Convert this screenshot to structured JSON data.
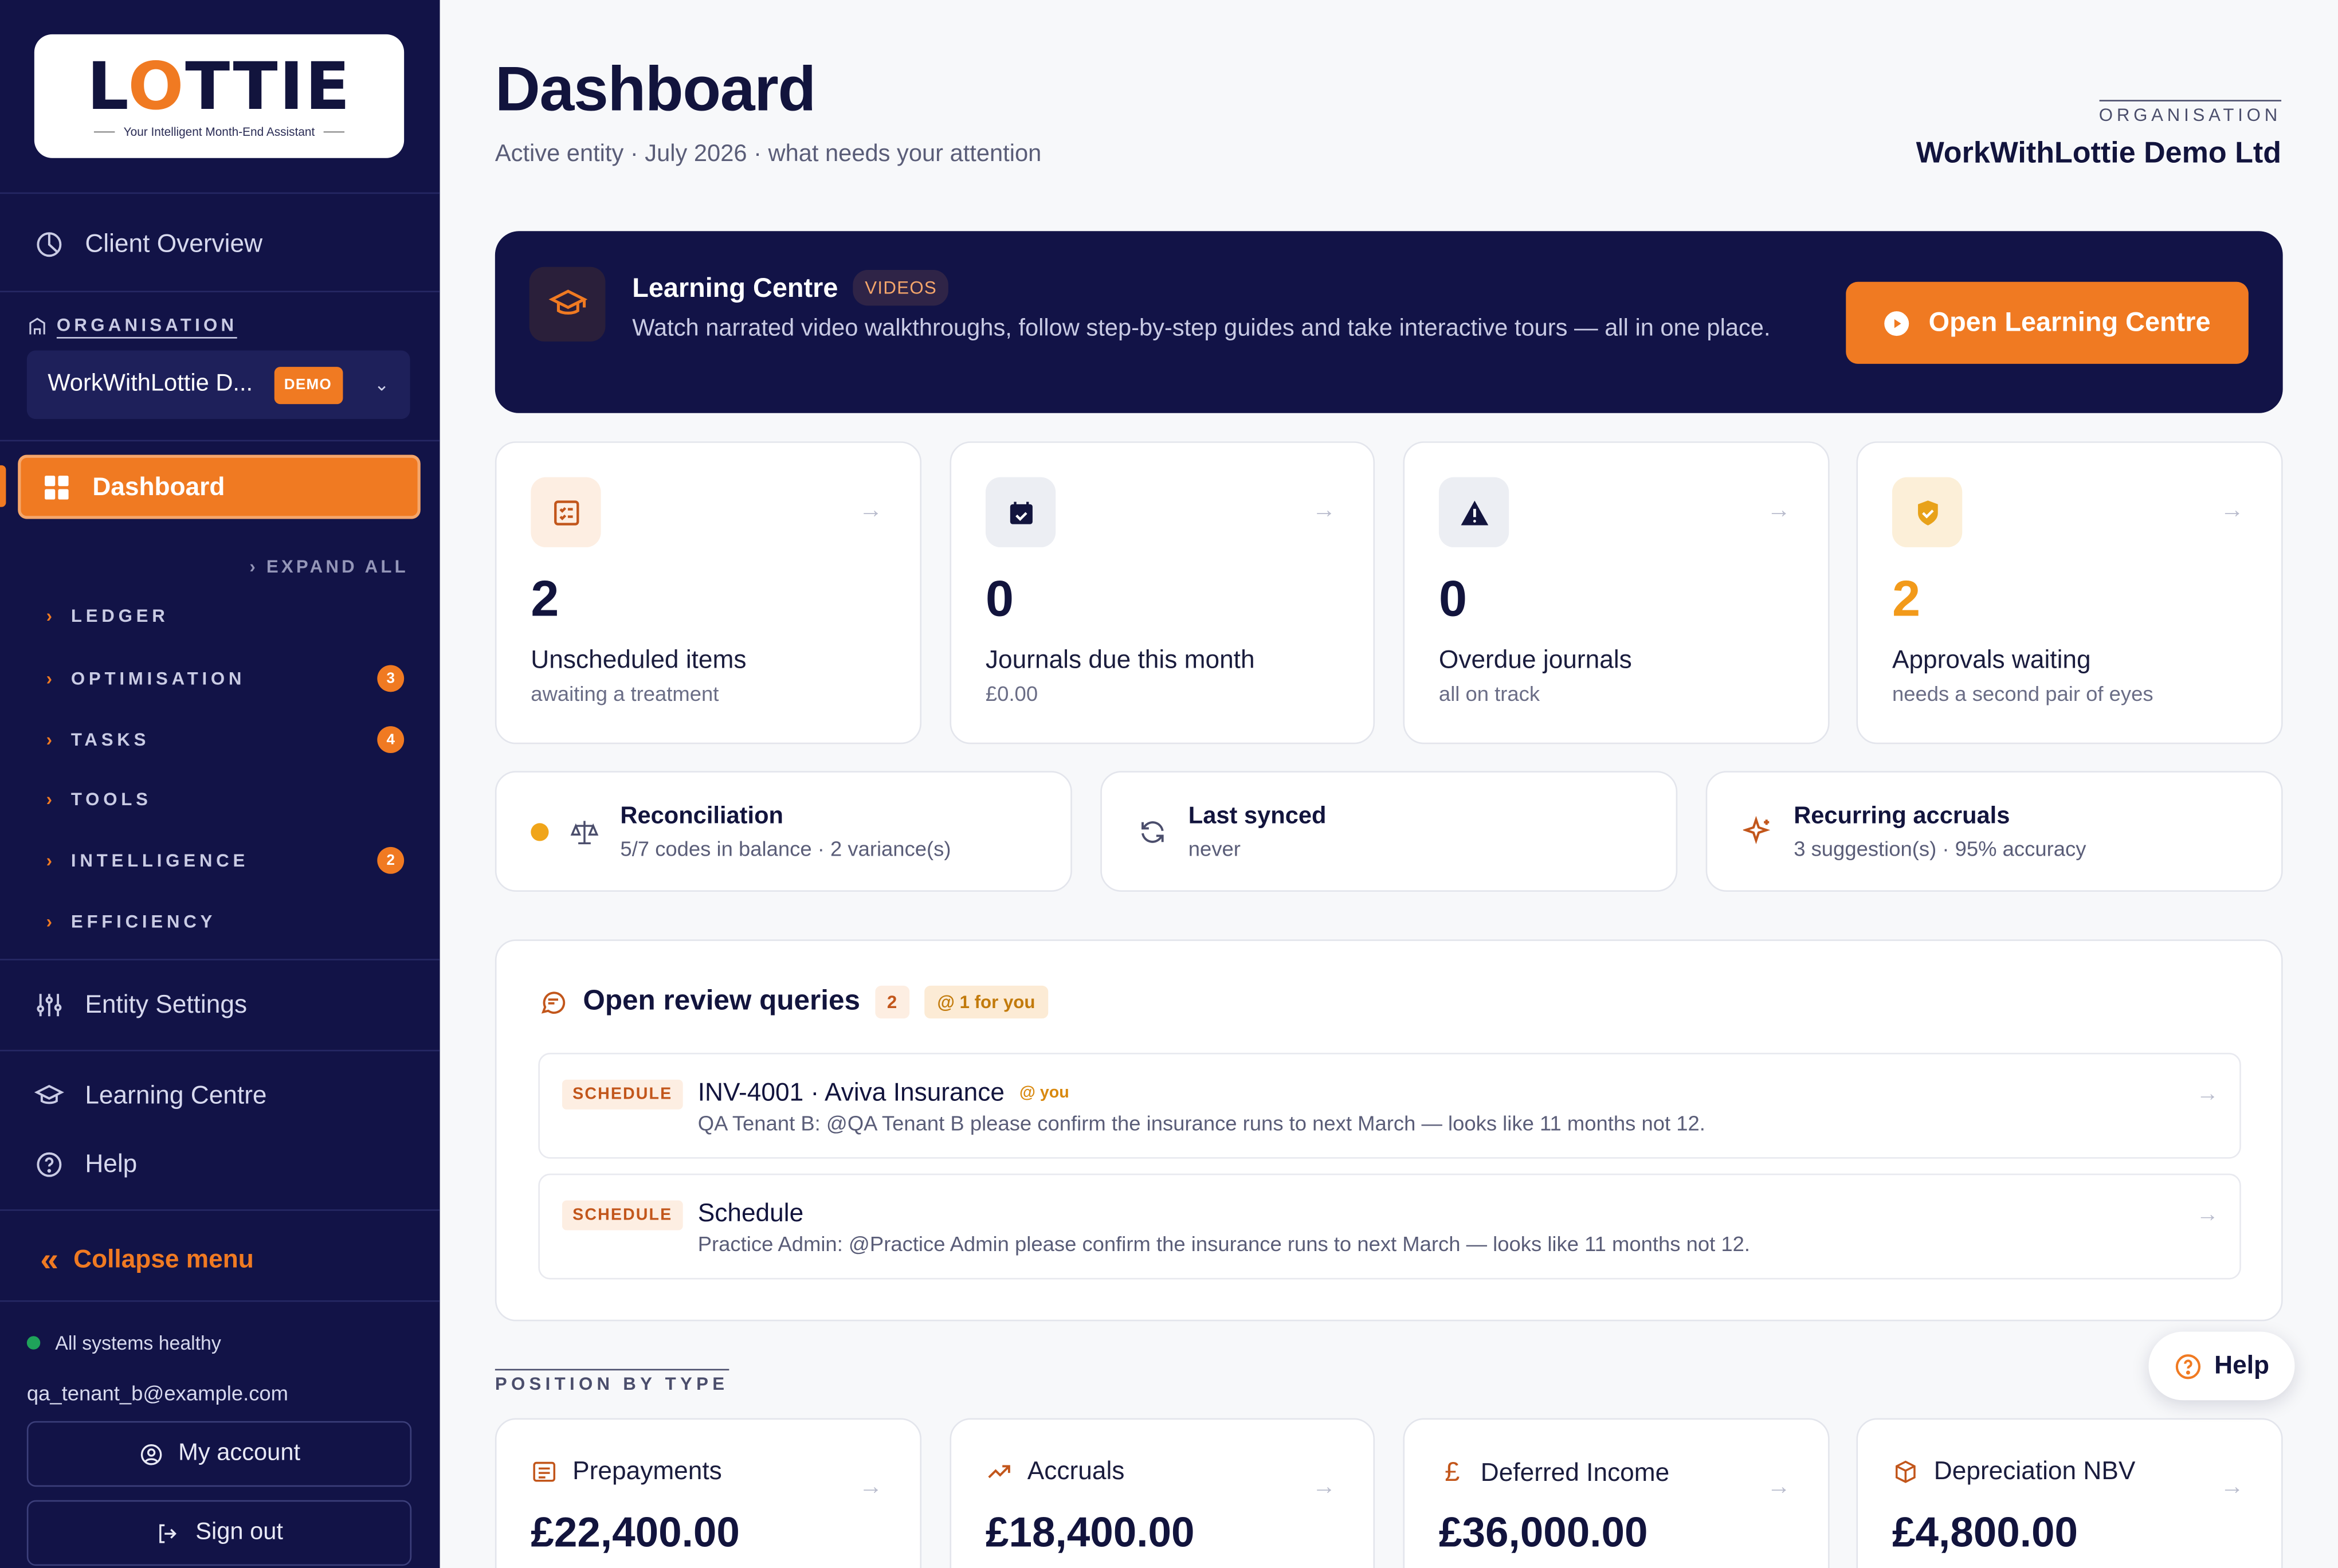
{
  "brand": {
    "logo_text_pre": "L",
    "logo_text_o": "O",
    "logo_text_post": "TTIE",
    "tagline": "Your Intelligent Month-End Assistant"
  },
  "sidebar": {
    "client_overview": "Client Overview",
    "org_label": "ORGANISATION",
    "org_selected": "WorkWithLottie D...",
    "org_badge": "DEMO",
    "dashboard": "Dashboard",
    "expand_all": "EXPAND ALL",
    "sections": [
      {
        "label": "LEDGER",
        "count": ""
      },
      {
        "label": "OPTIMISATION",
        "count": "3"
      },
      {
        "label": "TASKS",
        "count": "4"
      },
      {
        "label": "TOOLS",
        "count": ""
      },
      {
        "label": "INTELLIGENCE",
        "count": "2"
      },
      {
        "label": "EFFICIENCY",
        "count": ""
      }
    ],
    "entity_settings": "Entity Settings",
    "learning_centre": "Learning Centre",
    "help": "Help",
    "collapse": "Collapse menu",
    "health": "All systems healthy",
    "email": "qa_tenant_b@example.com",
    "my_account": "My account",
    "sign_out": "Sign out"
  },
  "header": {
    "title": "Dashboard",
    "subtitle": "Active entity · July 2026 · what needs your attention",
    "org_label": "ORGANISATION",
    "org_name": "WorkWithLottie Demo Ltd"
  },
  "learning_banner": {
    "title": "Learning Centre",
    "badge": "VIDEOS",
    "description": "Watch narrated video walkthroughs, follow step-by-step guides and take interactive tours — all in one place.",
    "button": "Open Learning Centre"
  },
  "stats": [
    {
      "value": "2",
      "label": "Unscheduled items",
      "sub": "awaiting a treatment",
      "icon": "checklist-icon",
      "color": "#c2561b",
      "bg": "#fdeee2",
      "numcolor": "#12143d"
    },
    {
      "value": "0",
      "label": "Journals due this month",
      "sub": "£0.00",
      "icon": "calendar-check-icon",
      "color": "#12143d",
      "bg": "#eceef3",
      "numcolor": "#12143d"
    },
    {
      "value": "0",
      "label": "Overdue journals",
      "sub": "all on track",
      "icon": "warning-icon",
      "color": "#12143d",
      "bg": "#eceef3",
      "numcolor": "#12143d"
    },
    {
      "value": "2",
      "label": "Approvals waiting",
      "sub": "needs a second pair of eyes",
      "icon": "shield-check-icon",
      "color": "#e8a21a",
      "bg": "#fcefd8",
      "numcolor": "#f29a1a"
    }
  ],
  "mini": [
    {
      "title": "Reconciliation",
      "sub": "5/7 codes in balance · 2 variance(s)",
      "icon": "scale-icon"
    },
    {
      "title": "Last synced",
      "sub": "never",
      "icon": "sync-icon"
    },
    {
      "title": "Recurring accruals",
      "sub": "3 suggestion(s) · 95% accuracy",
      "icon": "sparkle-icon"
    }
  ],
  "review": {
    "title": "Open review queries",
    "count": "2",
    "for_you": "@ 1 for you",
    "items": [
      {
        "tag": "SCHEDULE",
        "title": "INV-4001 · Aviva Insurance",
        "you": "@ you",
        "text": "QA Tenant B: @QA Tenant B please confirm the insurance runs to next March — looks like 11 months not 12."
      },
      {
        "tag": "SCHEDULE",
        "title": "Schedule",
        "you": "",
        "text": "Practice Admin: @Practice Admin please confirm the insurance runs to next March — looks like 11 months not 12."
      }
    ]
  },
  "position": {
    "label": "POSITION BY TYPE",
    "items": [
      {
        "title": "Prepayments",
        "value": "£22,400.00",
        "icon": "list-icon"
      },
      {
        "title": "Accruals",
        "value": "£18,400.00",
        "icon": "trend-up-icon"
      },
      {
        "title": "Deferred Income",
        "value": "£36,000.00",
        "icon": "pound-icon"
      },
      {
        "title": "Depreciation NBV",
        "value": "£4,800.00",
        "icon": "box-icon"
      }
    ]
  },
  "help_button": "Help"
}
